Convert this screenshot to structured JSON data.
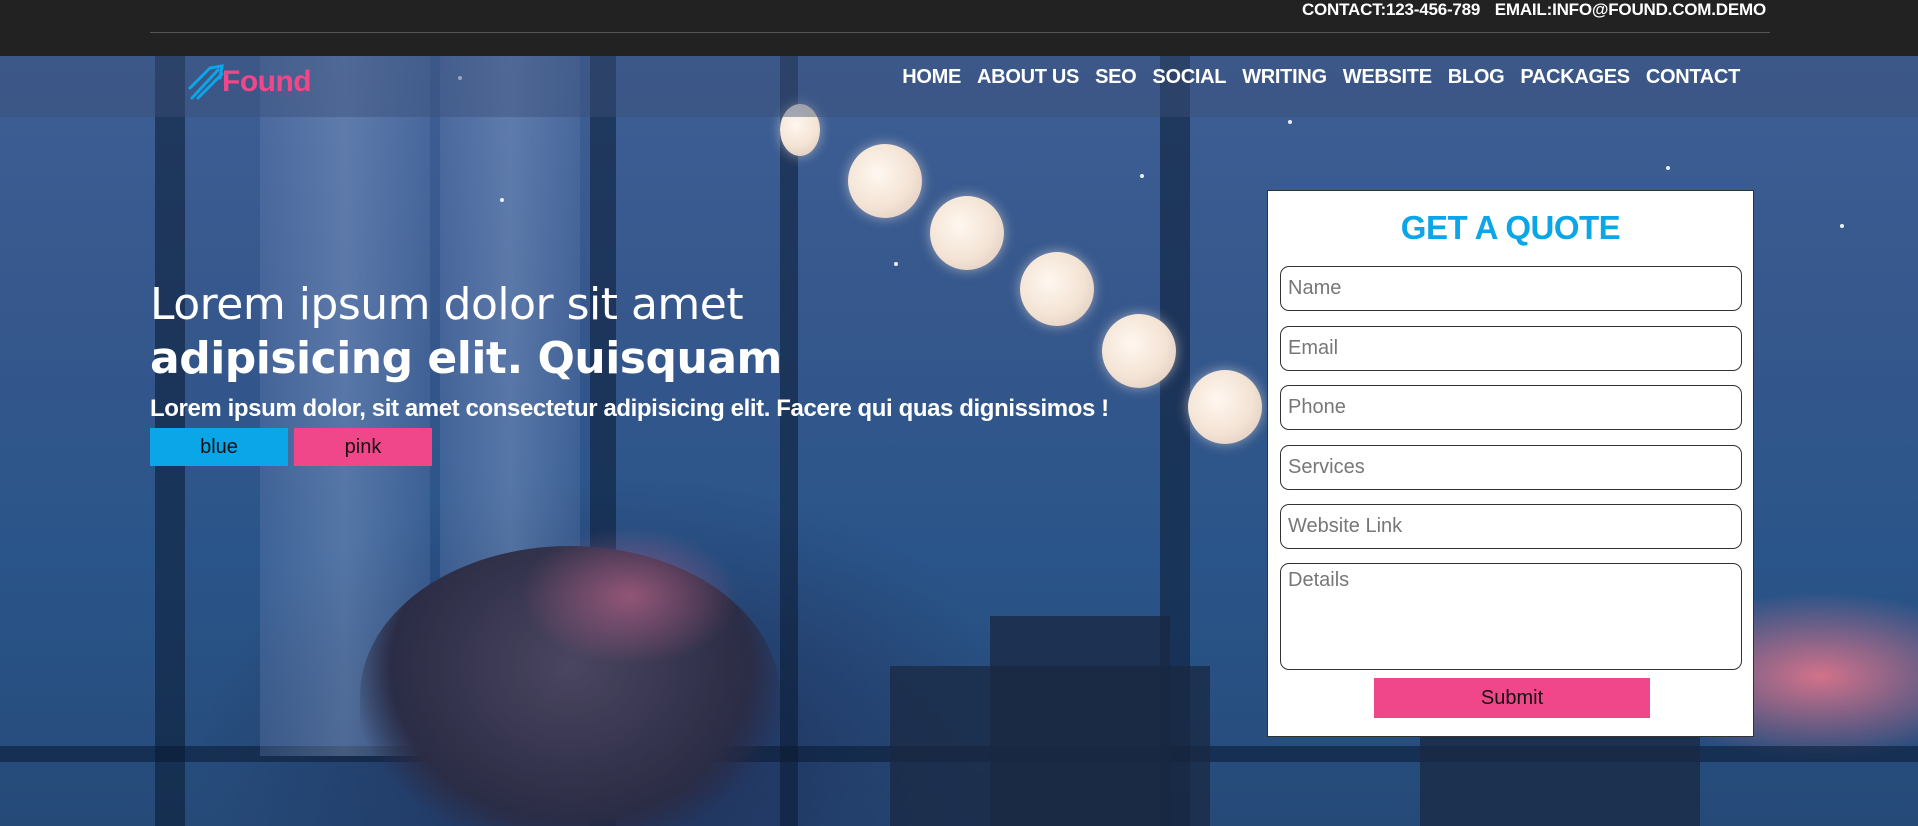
{
  "topbar": {
    "contact": "CONTACT:123-456-789",
    "email": "EMAIL:INFO@FOUND.COM.DEMO"
  },
  "brand": {
    "name": "Found",
    "icon": "arrows-logo-icon",
    "accent": "#f0468a",
    "secondary": "#0aa6e8"
  },
  "nav": {
    "items": [
      "HOME",
      "ABOUT US",
      "SEO",
      "SOCIAL",
      "WRITING",
      "WEBSITE",
      "BLOG",
      "PACKAGES",
      "CONTACT"
    ]
  },
  "hero": {
    "headline_line1": "Lorem ipsum dolor sit amet",
    "headline_line2": "adipisicing elit. Quisquam",
    "subline": "Lorem ipsum dolor, sit amet consectetur adipisicing elit. Facere qui quas dignissimos !",
    "buttons": {
      "blue": "blue",
      "pink": "pink"
    }
  },
  "quote": {
    "title": "GET A QUOTE",
    "fields": {
      "name": "Name",
      "email": "Email",
      "phone": "Phone",
      "services": "Services",
      "website": "Website Link",
      "details": "Details"
    },
    "submit": "Submit"
  },
  "colors": {
    "topbar": "#222222",
    "blue": "#0aa6e8",
    "pink": "#f0468a"
  }
}
